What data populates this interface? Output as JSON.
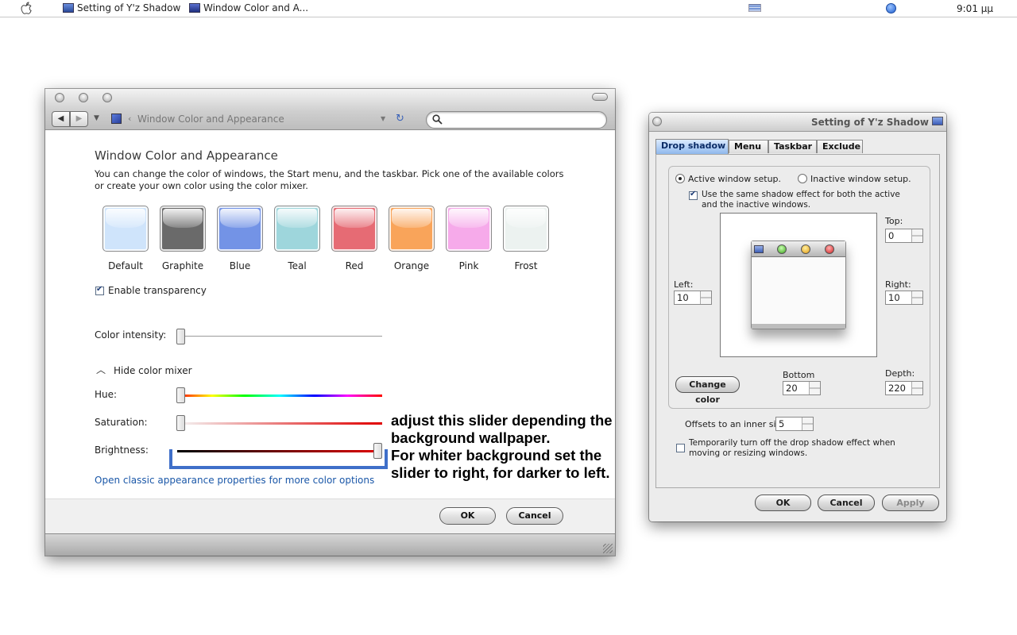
{
  "menubar": {
    "items": [
      "Setting of Y'z Shadow",
      "Window Color and A..."
    ],
    "clock": "9:01 μμ"
  },
  "window_main": {
    "breadcrumb": "Window Color and Appearance",
    "search_placeholder": "",
    "heading": "Window Color and Appearance",
    "description": "You can change the color of windows, the Start menu, and the taskbar. Pick one of the available colors or create your own color using the color mixer.",
    "swatches": [
      {
        "label": "Default",
        "color": "#cfe4fb"
      },
      {
        "label": "Graphite",
        "color": "#6a6a6a"
      },
      {
        "label": "Blue",
        "color": "#7393e6"
      },
      {
        "label": "Teal",
        "color": "#9ed6dc"
      },
      {
        "label": "Red",
        "color": "#e66b74"
      },
      {
        "label": "Orange",
        "color": "#f9a45a"
      },
      {
        "label": "Pink",
        "color": "#f6aaea"
      },
      {
        "label": "Frost",
        "color": "#ecf2f0"
      }
    ],
    "enable_transparency": {
      "label": "Enable transparency",
      "checked": true
    },
    "color_intensity": {
      "label": "Color intensity:",
      "value": 0
    },
    "mixer_toggle": "Hide color mixer",
    "hue": {
      "label": "Hue:",
      "value": 0
    },
    "saturation": {
      "label": "Saturation:",
      "value": 0
    },
    "brightness": {
      "label": "Brightness:",
      "value": 1
    },
    "classic_link": "Open classic appearance properties for more color options",
    "ok": "OK",
    "cancel": "Cancel"
  },
  "annotation": {
    "lines": [
      "adjust this slider depending the",
      "background wallpaper.",
      "For whiter background set the",
      "slider to right, for darker to left."
    ]
  },
  "window_shadow": {
    "title": "Setting of Y'z Shadow",
    "tabs": [
      "Drop shadow",
      "Menu",
      "Taskbar",
      "Exclude"
    ],
    "active_tab": "Drop shadow",
    "active_setup": "Active window setup.",
    "inactive_setup": "Inactive window setup.",
    "same_effect": "Use the same shadow effect for both the active and the inactive windows.",
    "top": {
      "label": "Top:",
      "value": "0"
    },
    "left": {
      "label": "Left:",
      "value": "10"
    },
    "right": {
      "label": "Right:",
      "value": "10"
    },
    "bottom": {
      "label": "Bottom",
      "value": "20"
    },
    "depth": {
      "label": "Depth:",
      "value": "220"
    },
    "change_color": "Change color",
    "offsets": {
      "label": "Offsets to an inner side:",
      "value": "5"
    },
    "temp_off": "Temporarily turn off the drop shadow effect when moving or resizing windows.",
    "ok": "OK",
    "cancel": "Cancel",
    "apply": "Apply"
  }
}
